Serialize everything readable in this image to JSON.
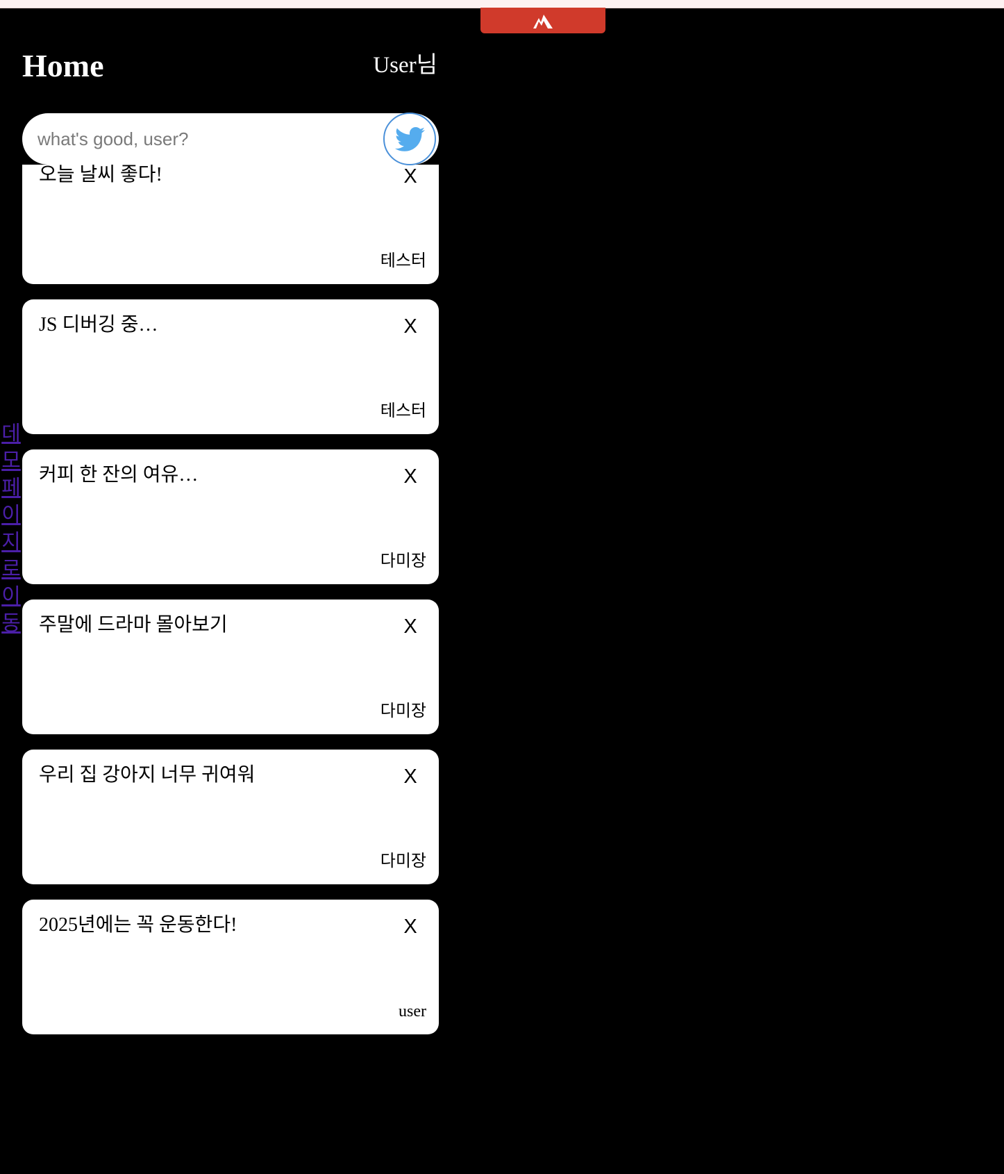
{
  "header": {
    "title": "Home",
    "user_label": "User님"
  },
  "composer": {
    "placeholder": "what's good, user?"
  },
  "side_link": {
    "label": "데모페이지로이동"
  },
  "feed": {
    "close_label": "X",
    "tweets": [
      {
        "text": "오늘 날씨 좋다!",
        "author": "테스터"
      },
      {
        "text": "JS 디버깅 중…",
        "author": "테스터"
      },
      {
        "text": "커피 한 잔의 여유…",
        "author": "다미장"
      },
      {
        "text": "주말에 드라마 몰아보기",
        "author": "다미장"
      },
      {
        "text": "우리 집 강아지 너무 귀여워",
        "author": "다미장"
      },
      {
        "text": "2025년에는 꼭 운동한다!",
        "author": "user"
      },
      {
        "text": "",
        "author": ""
      }
    ]
  },
  "colors": {
    "background": "#000000",
    "card": "#ffffff",
    "extension_tab": "#d03a2b",
    "twitter_blue": "#55acee",
    "link": "#4b1fa8"
  },
  "icons": {
    "extension": "mountain-icon",
    "submit": "bird-icon"
  }
}
